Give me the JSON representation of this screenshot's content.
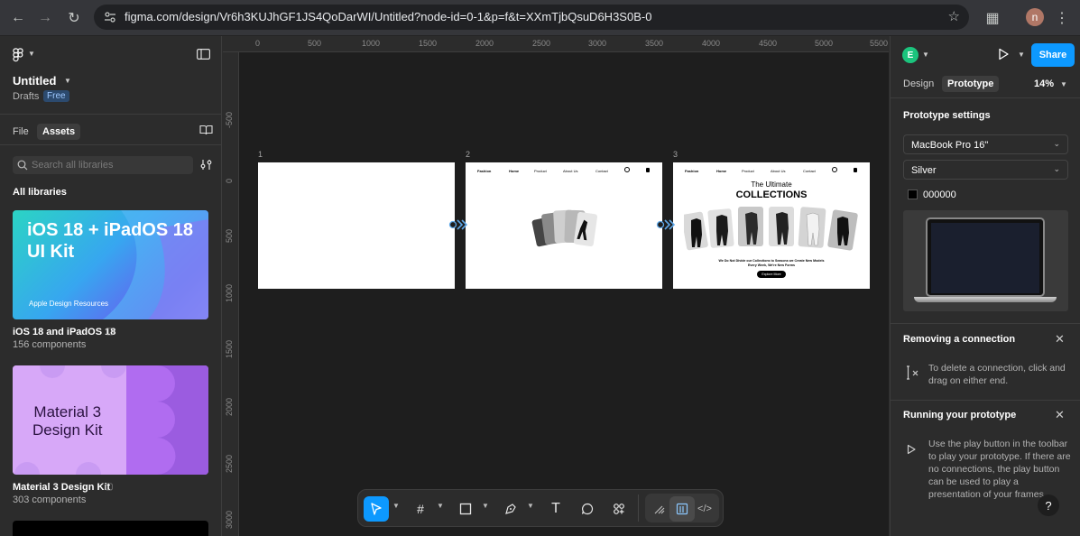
{
  "browser": {
    "url": "figma.com/design/Vr6h3KUJhGF1JS4QoDarWI/Untitled?node-id=0-1&p=f&t=XXmTjbQsuD6H3S0B-0",
    "profile_initial": "n"
  },
  "left_panel": {
    "file_title": "Untitled",
    "location": "Drafts",
    "plan_badge": "Free",
    "tabs": [
      "File",
      "Assets"
    ],
    "active_tab": "Assets",
    "search_placeholder": "Search all libraries",
    "section_heading": "All libraries",
    "libraries": [
      {
        "thumb_title": "iOS 18 + iPadOS 18\nUI Kit",
        "thumb_caption": "Apple Design Resources",
        "name": "iOS 18 and iPadOS 18",
        "count": "156 components"
      },
      {
        "thumb_title": "Material 3\nDesign Kit",
        "name": "Material 3 Design Kit",
        "count": "303 components"
      }
    ]
  },
  "canvas": {
    "ruler_top": [
      "0",
      "500",
      "1000",
      "1500",
      "2000",
      "2500",
      "3000",
      "3500",
      "4000",
      "4500",
      "5000",
      "5500"
    ],
    "ruler_left": [
      "-500",
      "0",
      "500",
      "1000",
      "1500",
      "2000",
      "2500",
      "3000"
    ],
    "frames": [
      {
        "label": "1"
      },
      {
        "label": "2",
        "nav": {
          "brand": "Fashion",
          "links": [
            "Home",
            "Product",
            "About Us",
            "Contact"
          ]
        }
      },
      {
        "label": "3",
        "nav": {
          "brand": "Fashion",
          "links": [
            "Home",
            "Product",
            "About Us",
            "Contact"
          ]
        },
        "headline_small": "The Ultimate",
        "headline_big": "COLLECTIONS",
        "tagline": "We Do Not Divide our Collections to Seasons we Create New Models Every Week, We're New Forms",
        "cta": "Explore More"
      }
    ]
  },
  "right_panel": {
    "user_initial": "E",
    "share_label": "Share",
    "tabs": [
      "Design",
      "Prototype"
    ],
    "active_tab": "Prototype",
    "zoom": "14%",
    "prototype_settings_title": "Prototype settings",
    "device": "MacBook Pro 16\"",
    "device_color": "Silver",
    "background_hex": "000000",
    "removing_title": "Removing a connection",
    "removing_text": "To delete a connection, click and drag on either end.",
    "running_title": "Running your prototype",
    "running_text": "Use the play button in the toolbar to play your prototype. If there are no connections, the play button can be used to play a presentation of your frames.",
    "help": "?"
  },
  "colors": {
    "accent": "#0d99ff",
    "canvas": "#1e1e1e",
    "panel": "#2c2c2c"
  }
}
